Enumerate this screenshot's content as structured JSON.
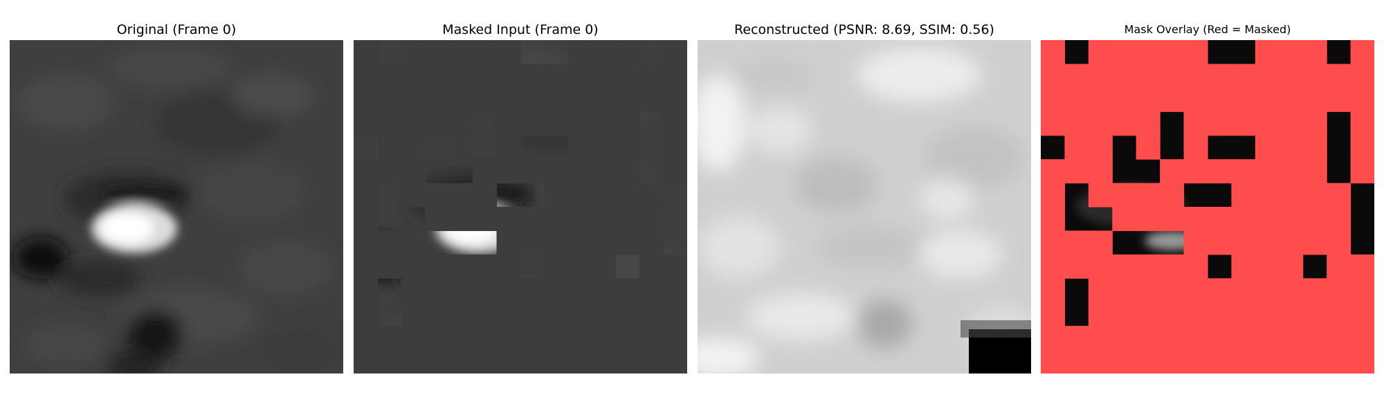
{
  "figure": {
    "panels": [
      {
        "id": "original",
        "title": "Original (Frame 0)"
      },
      {
        "id": "masked",
        "title": "Masked Input (Frame 0)"
      },
      {
        "id": "reconstructed",
        "title": "Reconstructed (PSNR: 8.69, SSIM: 0.56)"
      },
      {
        "id": "overlay",
        "title": "Mask Overlay (Red = Masked)"
      }
    ],
    "grid": {
      "rows": 14,
      "cols": 14,
      "masked_cells": [
        [
          0,
          0
        ],
        [
          0,
          2
        ],
        [
          0,
          3
        ],
        [
          0,
          4
        ],
        [
          0,
          5
        ],
        [
          0,
          6
        ],
        [
          0,
          9
        ],
        [
          0,
          10
        ],
        [
          0,
          11
        ],
        [
          0,
          13
        ],
        [
          1,
          0
        ],
        [
          1,
          1
        ],
        [
          1,
          2
        ],
        [
          1,
          3
        ],
        [
          1,
          4
        ],
        [
          1,
          5
        ],
        [
          1,
          6
        ],
        [
          1,
          7
        ],
        [
          1,
          8
        ],
        [
          1,
          9
        ],
        [
          1,
          10
        ],
        [
          1,
          11
        ],
        [
          1,
          12
        ],
        [
          1,
          13
        ],
        [
          2,
          0
        ],
        [
          2,
          1
        ],
        [
          2,
          2
        ],
        [
          2,
          3
        ],
        [
          2,
          4
        ],
        [
          2,
          5
        ],
        [
          2,
          6
        ],
        [
          2,
          7
        ],
        [
          2,
          8
        ],
        [
          2,
          9
        ],
        [
          2,
          10
        ],
        [
          2,
          11
        ],
        [
          2,
          12
        ],
        [
          2,
          13
        ],
        [
          3,
          0
        ],
        [
          3,
          1
        ],
        [
          3,
          2
        ],
        [
          3,
          3
        ],
        [
          3,
          4
        ],
        [
          3,
          6
        ],
        [
          3,
          7
        ],
        [
          3,
          8
        ],
        [
          3,
          9
        ],
        [
          3,
          10
        ],
        [
          3,
          11
        ],
        [
          3,
          13
        ],
        [
          4,
          1
        ],
        [
          4,
          2
        ],
        [
          4,
          4
        ],
        [
          4,
          6
        ],
        [
          4,
          9
        ],
        [
          4,
          10
        ],
        [
          4,
          11
        ],
        [
          4,
          13
        ],
        [
          5,
          0
        ],
        [
          5,
          1
        ],
        [
          5,
          2
        ],
        [
          5,
          5
        ],
        [
          5,
          6
        ],
        [
          5,
          7
        ],
        [
          5,
          8
        ],
        [
          5,
          9
        ],
        [
          5,
          10
        ],
        [
          5,
          11
        ],
        [
          5,
          13
        ],
        [
          6,
          0
        ],
        [
          6,
          2
        ],
        [
          6,
          3
        ],
        [
          6,
          4
        ],
        [
          6,
          5
        ],
        [
          6,
          8
        ],
        [
          6,
          9
        ],
        [
          6,
          10
        ],
        [
          6,
          11
        ],
        [
          6,
          12
        ],
        [
          7,
          0
        ],
        [
          7,
          3
        ],
        [
          7,
          4
        ],
        [
          7,
          5
        ],
        [
          7,
          6
        ],
        [
          7,
          7
        ],
        [
          7,
          8
        ],
        [
          7,
          9
        ],
        [
          7,
          10
        ],
        [
          7,
          11
        ],
        [
          7,
          12
        ],
        [
          8,
          0
        ],
        [
          8,
          1
        ],
        [
          8,
          2
        ],
        [
          8,
          6
        ],
        [
          8,
          7
        ],
        [
          8,
          8
        ],
        [
          8,
          9
        ],
        [
          8,
          10
        ],
        [
          8,
          11
        ],
        [
          8,
          12
        ],
        [
          9,
          0
        ],
        [
          9,
          1
        ],
        [
          9,
          2
        ],
        [
          9,
          3
        ],
        [
          9,
          4
        ],
        [
          9,
          5
        ],
        [
          9,
          6
        ],
        [
          9,
          8
        ],
        [
          9,
          9
        ],
        [
          9,
          10
        ],
        [
          9,
          12
        ],
        [
          9,
          13
        ],
        [
          10,
          0
        ],
        [
          10,
          2
        ],
        [
          10,
          3
        ],
        [
          10,
          4
        ],
        [
          10,
          5
        ],
        [
          10,
          6
        ],
        [
          10,
          7
        ],
        [
          10,
          8
        ],
        [
          10,
          9
        ],
        [
          10,
          10
        ],
        [
          10,
          11
        ],
        [
          10,
          12
        ],
        [
          10,
          13
        ],
        [
          11,
          0
        ],
        [
          11,
          2
        ],
        [
          11,
          3
        ],
        [
          11,
          4
        ],
        [
          11,
          5
        ],
        [
          11,
          6
        ],
        [
          11,
          7
        ],
        [
          11,
          8
        ],
        [
          11,
          9
        ],
        [
          11,
          10
        ],
        [
          11,
          11
        ],
        [
          11,
          12
        ],
        [
          11,
          13
        ],
        [
          12,
          0
        ],
        [
          12,
          1
        ],
        [
          12,
          2
        ],
        [
          12,
          3
        ],
        [
          12,
          4
        ],
        [
          12,
          5
        ],
        [
          12,
          6
        ],
        [
          12,
          7
        ],
        [
          12,
          8
        ],
        [
          12,
          9
        ],
        [
          12,
          10
        ],
        [
          12,
          11
        ],
        [
          12,
          12
        ],
        [
          12,
          13
        ],
        [
          13,
          0
        ],
        [
          13,
          1
        ],
        [
          13,
          2
        ],
        [
          13,
          3
        ],
        [
          13,
          4
        ],
        [
          13,
          5
        ],
        [
          13,
          6
        ],
        [
          13,
          7
        ],
        [
          13,
          8
        ],
        [
          13,
          9
        ],
        [
          13,
          10
        ],
        [
          13,
          11
        ],
        [
          13,
          12
        ],
        [
          13,
          13
        ]
      ]
    },
    "colors": {
      "mask_red": "#ff4d4d",
      "masked_fill_gray": "#3d3d3d",
      "background": "#ffffff"
    }
  }
}
